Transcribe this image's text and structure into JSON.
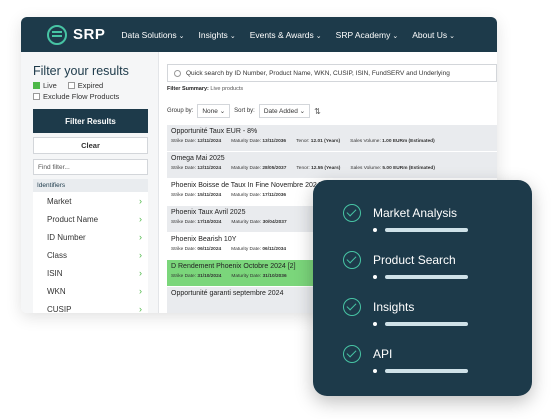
{
  "nav": {
    "logo": "SRP",
    "items": [
      "Data Solutions",
      "Insights",
      "Events & Awards",
      "SRP Academy",
      "About Us"
    ]
  },
  "sidebar": {
    "title": "Filter your results",
    "live": "Live",
    "expired": "Expired",
    "exclude": "Exclude Flow Products",
    "filter_btn": "Filter Results",
    "clear_btn": "Clear",
    "find_placeholder": "Find filter...",
    "identifiers_label": "Identifiers",
    "identifiers": [
      "Market",
      "Product Name",
      "ID Number",
      "Class",
      "ISIN",
      "WKN",
      "CUSIP"
    ]
  },
  "search": {
    "placeholder": "Quick search by ID Number, Product Name, WKN, CUSIP, ISIN, FundSERV and Underlying"
  },
  "summary": {
    "label": "Filter Summary:",
    "value": "Live products"
  },
  "controls": {
    "group_by": "Group by:",
    "group_value": "None",
    "sort_by": "Sort by:",
    "sort_value": "Date Added"
  },
  "results": [
    {
      "title": "Opportunité Taux EUR - 8%",
      "strike": "12/11/2024",
      "maturity": "13/11/2036",
      "tenor": "12.01 (Years)",
      "volume": "1.00 EURm (Estimated)"
    },
    {
      "title": "Omega Mai 2025",
      "strike": "12/11/2024",
      "maturity": "28/05/2037",
      "tenor": "12.55 (Years)",
      "volume": "5.00 EURm (Estimated)"
    },
    {
      "title": "Phoenix Boisse de Taux In Fine Novembre 2024",
      "strike": "15/11/2024",
      "maturity": "17/11/2036",
      "tenor": "",
      "volume": ""
    },
    {
      "title": "Phoenix Taux Avril 2025",
      "strike": "17/10/2024",
      "maturity": "30/04/2037",
      "tenor": "",
      "volume": ""
    },
    {
      "title": "Phoenix Bearish 10Y",
      "strike": "06/11/2024",
      "maturity": "06/11/2034",
      "tenor": "",
      "volume": ""
    },
    {
      "title": "D Rendement Phoenix Octobre 2024 [2]",
      "strike": "31/10/2024",
      "maturity": "31/10/2036",
      "tenor": "",
      "volume": ""
    },
    {
      "title": "Opportunité garanti septembre 2024",
      "strike": "",
      "maturity": "",
      "tenor": "",
      "volume": ""
    }
  ],
  "meta_labels": {
    "strike": "Strike Date:",
    "maturity": "Maturity Date:",
    "tenor": "Tenor:",
    "volume": "Sales Volume:"
  },
  "features": [
    "Market Analysis",
    "Product Search",
    "Insights",
    "API"
  ],
  "colors": {
    "navy": "#1d3a4a",
    "accent": "#47c4a4",
    "green": "#4db848",
    "highlight": "#7bd67b"
  }
}
